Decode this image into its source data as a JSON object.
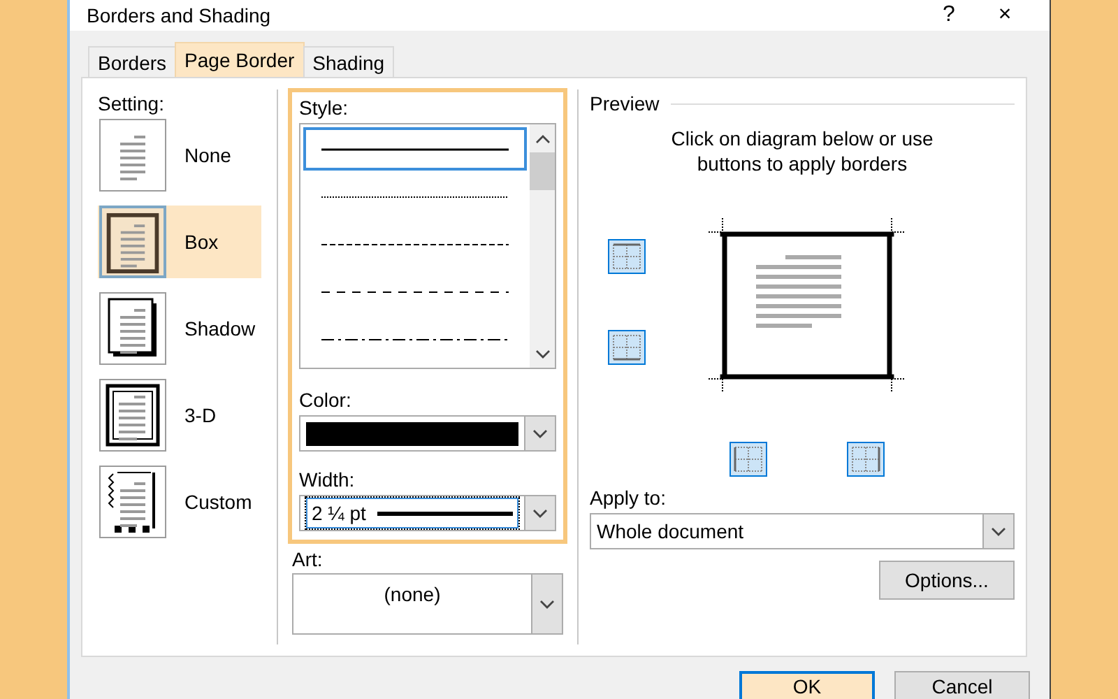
{
  "window": {
    "title": "Borders and Shading",
    "help": "?",
    "close": "×"
  },
  "tabs": [
    {
      "label": "Borders",
      "selected": false
    },
    {
      "label": "Page Border",
      "selected": true
    },
    {
      "label": "Shading",
      "selected": false
    }
  ],
  "setting": {
    "label": "Setting:",
    "items": [
      {
        "kind": "none",
        "label": "None",
        "selected": false
      },
      {
        "kind": "box",
        "label": "Box",
        "selected": true
      },
      {
        "kind": "shadow",
        "label": "Shadow",
        "selected": false
      },
      {
        "kind": "threed",
        "label": "3-D",
        "selected": false
      },
      {
        "kind": "custom",
        "label": "Custom",
        "selected": false
      }
    ]
  },
  "style": {
    "label": "Style:",
    "items": [
      {
        "kind": "solid",
        "selected": true
      },
      {
        "kind": "dotted",
        "selected": false
      },
      {
        "kind": "dashed",
        "selected": false
      },
      {
        "kind": "dashed-wide",
        "selected": false
      },
      {
        "kind": "dash-dot",
        "selected": false
      }
    ]
  },
  "color": {
    "label": "Color:",
    "color": "#000000"
  },
  "width": {
    "label": "Width:",
    "value": "2 ¼ pt"
  },
  "art": {
    "label": "Art:",
    "value": "(none)"
  },
  "preview": {
    "label": "Preview",
    "hint": "Click on diagram below or use buttons to apply borders",
    "border_buttons": [
      {
        "kind": "top",
        "on": true
      },
      {
        "kind": "bottom",
        "on": true
      },
      {
        "kind": "left",
        "on": true
      },
      {
        "kind": "right",
        "on": true
      }
    ]
  },
  "apply_to": {
    "label": "Apply to:",
    "value": "Whole document"
  },
  "options_button": "Options...",
  "buttons": [
    {
      "label": "OK",
      "selected": true
    },
    {
      "label": "Cancel",
      "selected": false
    }
  ]
}
